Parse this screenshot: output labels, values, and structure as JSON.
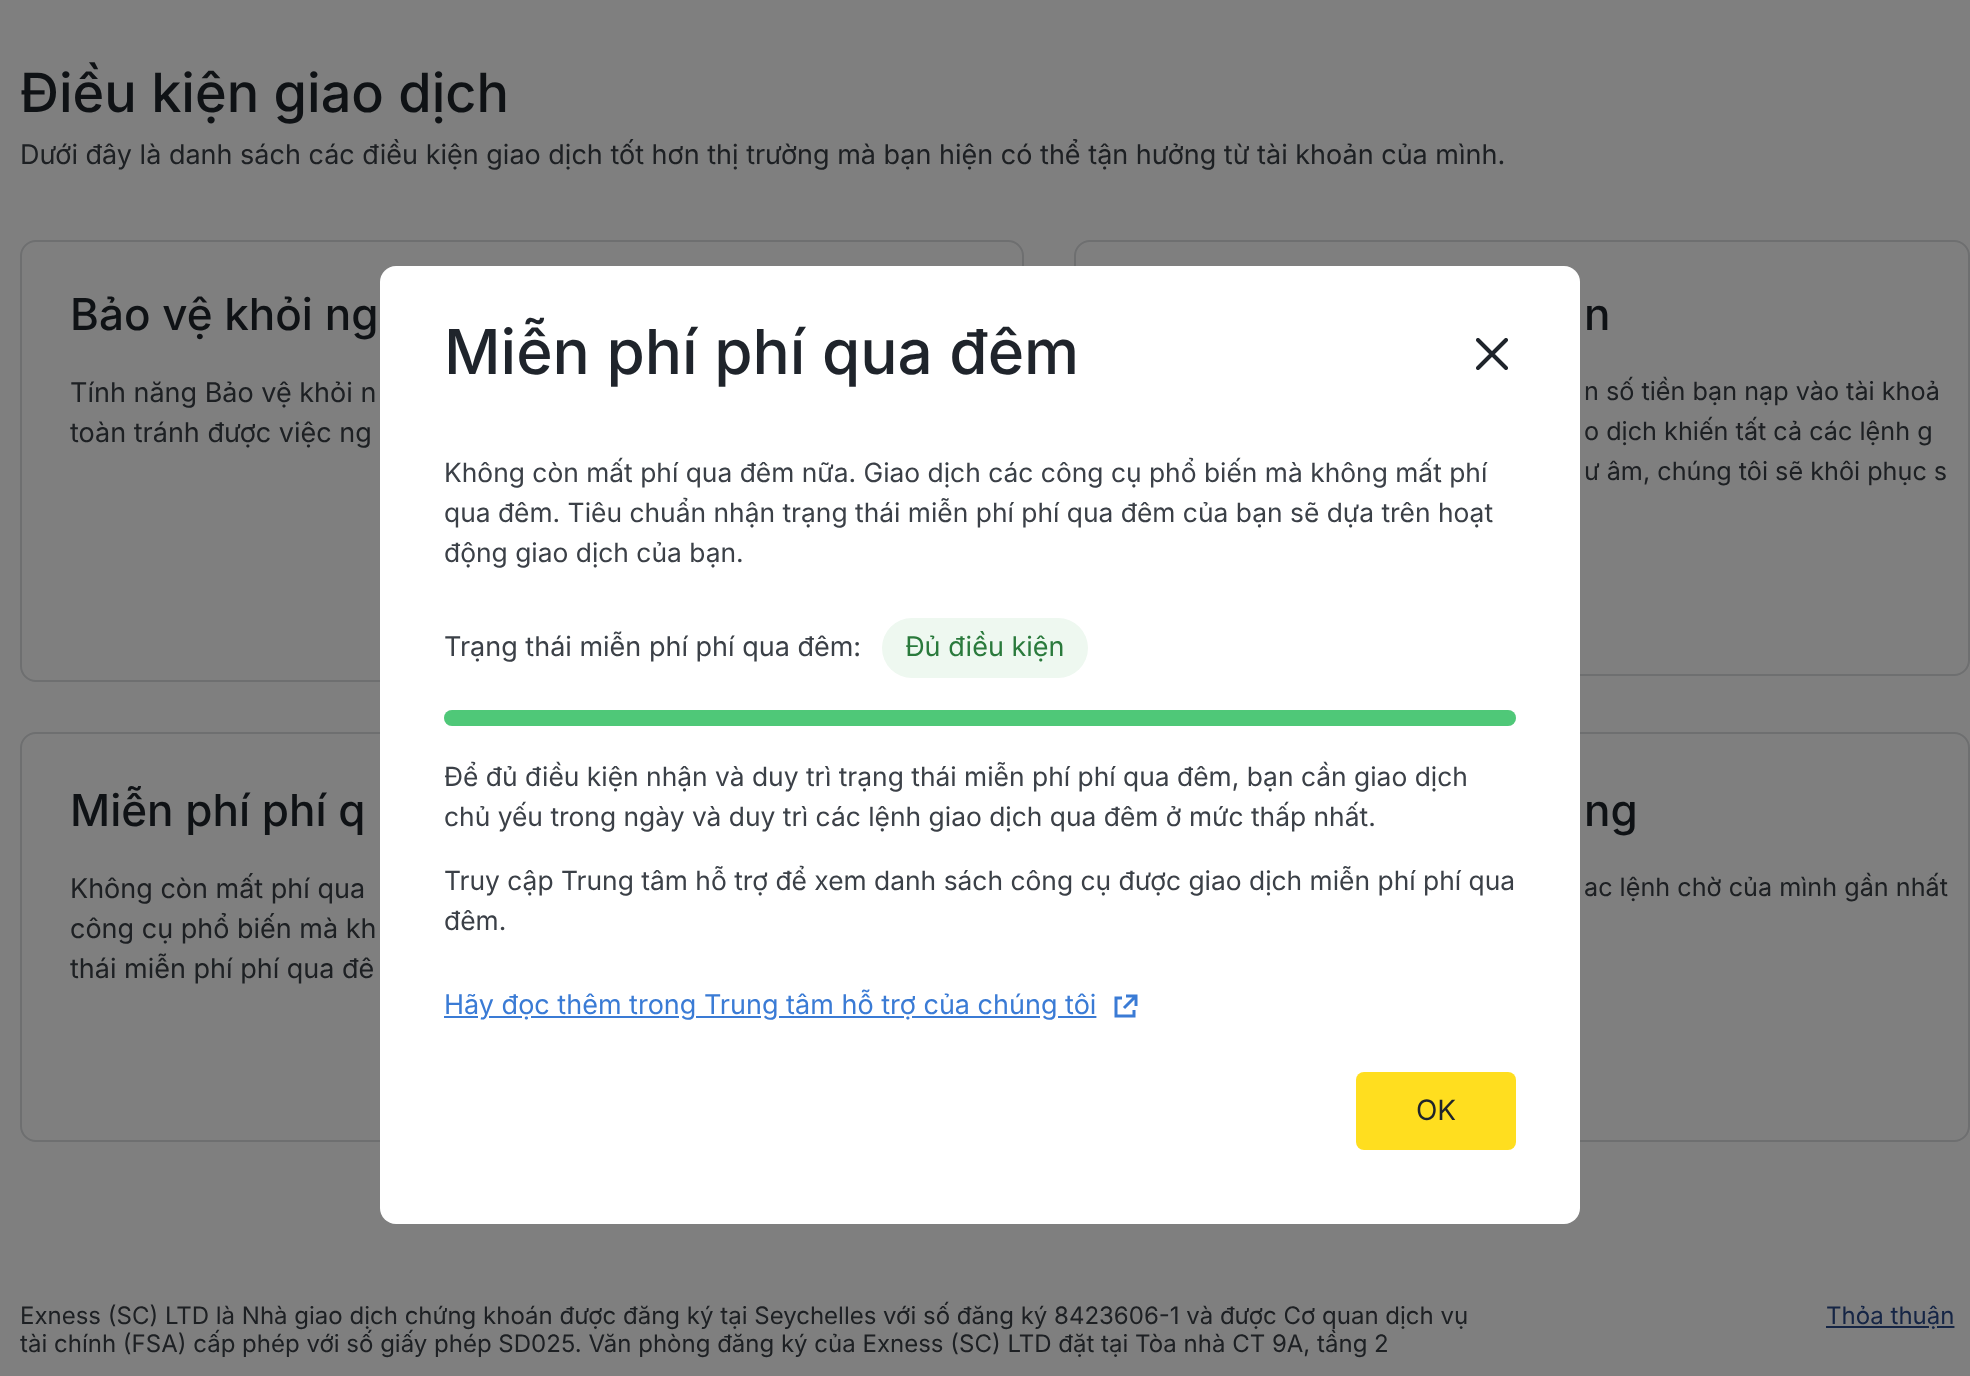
{
  "page": {
    "title": "Điều kiện giao dịch",
    "subtitle": "Dưới đây là danh sách các điều kiện giao dịch tốt hơn thị trường mà bạn hiện có thể tận hưởng từ tài khoản của mình."
  },
  "cards": [
    {
      "title": "Bảo vệ khỏi ng",
      "lines": [
        "Tính năng Bảo vệ khỏi n",
        "toàn tránh được việc ng"
      ]
    },
    {
      "title": "n",
      "lines": [
        "n số tiền bạn nạp vào tài khoả",
        "o dịch khiến tất cả các lệnh g",
        "ư âm, chúng tôi sẽ khôi phục s"
      ]
    },
    {
      "title": "Miễn phí phí q",
      "lines": [
        "Không còn mất phí qua",
        "công cụ phổ biến mà kh",
        "thái miễn phí phí qua đê"
      ]
    },
    {
      "title": "ng",
      "lines": [
        "ac lệnh chờ của mình gần nhất"
      ]
    }
  ],
  "footer": {
    "lines": [
      "Exness (SC) LTD là Nhà giao dịch chứng khoán được đăng ký tại Seychelles với số đăng ký 8423606-1 và được Cơ quan dịch vụ",
      "tài chính (FSA) cấp phép với số giấy phép SD025. Văn phòng đăng ký của Exness (SC) LTD đặt tại Tòa nhà CT 9A, tầng 2"
    ],
    "link": "Thỏa thuận"
  },
  "dialog": {
    "title": "Miễn phí phí qua đêm",
    "intro": "Không còn mất phí qua đêm nữa. Giao dịch các công cụ phổ biến mà không mất phí qua đêm. Tiêu chuẩn nhận trạng thái miễn phí phí qua đêm của bạn sẽ dựa trên hoạt động giao dịch của bạn.",
    "status_label": "Trạng thái miễn phí phí qua đêm:",
    "status_badge": "Đủ điều kiện",
    "progress": {
      "level": 1
    },
    "paragraphs": [
      "Để đủ điều kiện nhận và duy trì trạng thái miễn phí phí qua đêm, bạn cần giao dịch chủ yếu trong ngày và duy trì các lệnh giao dịch qua đêm ở mức thấp nhất.",
      "Truy cập Trung tâm hỗ trợ để xem danh sách công cụ được giao dịch miễn phí phí qua đêm."
    ],
    "link": "Hãy đọc thêm trong Trung tâm hỗ trợ của chúng tôi",
    "button": "OK"
  }
}
